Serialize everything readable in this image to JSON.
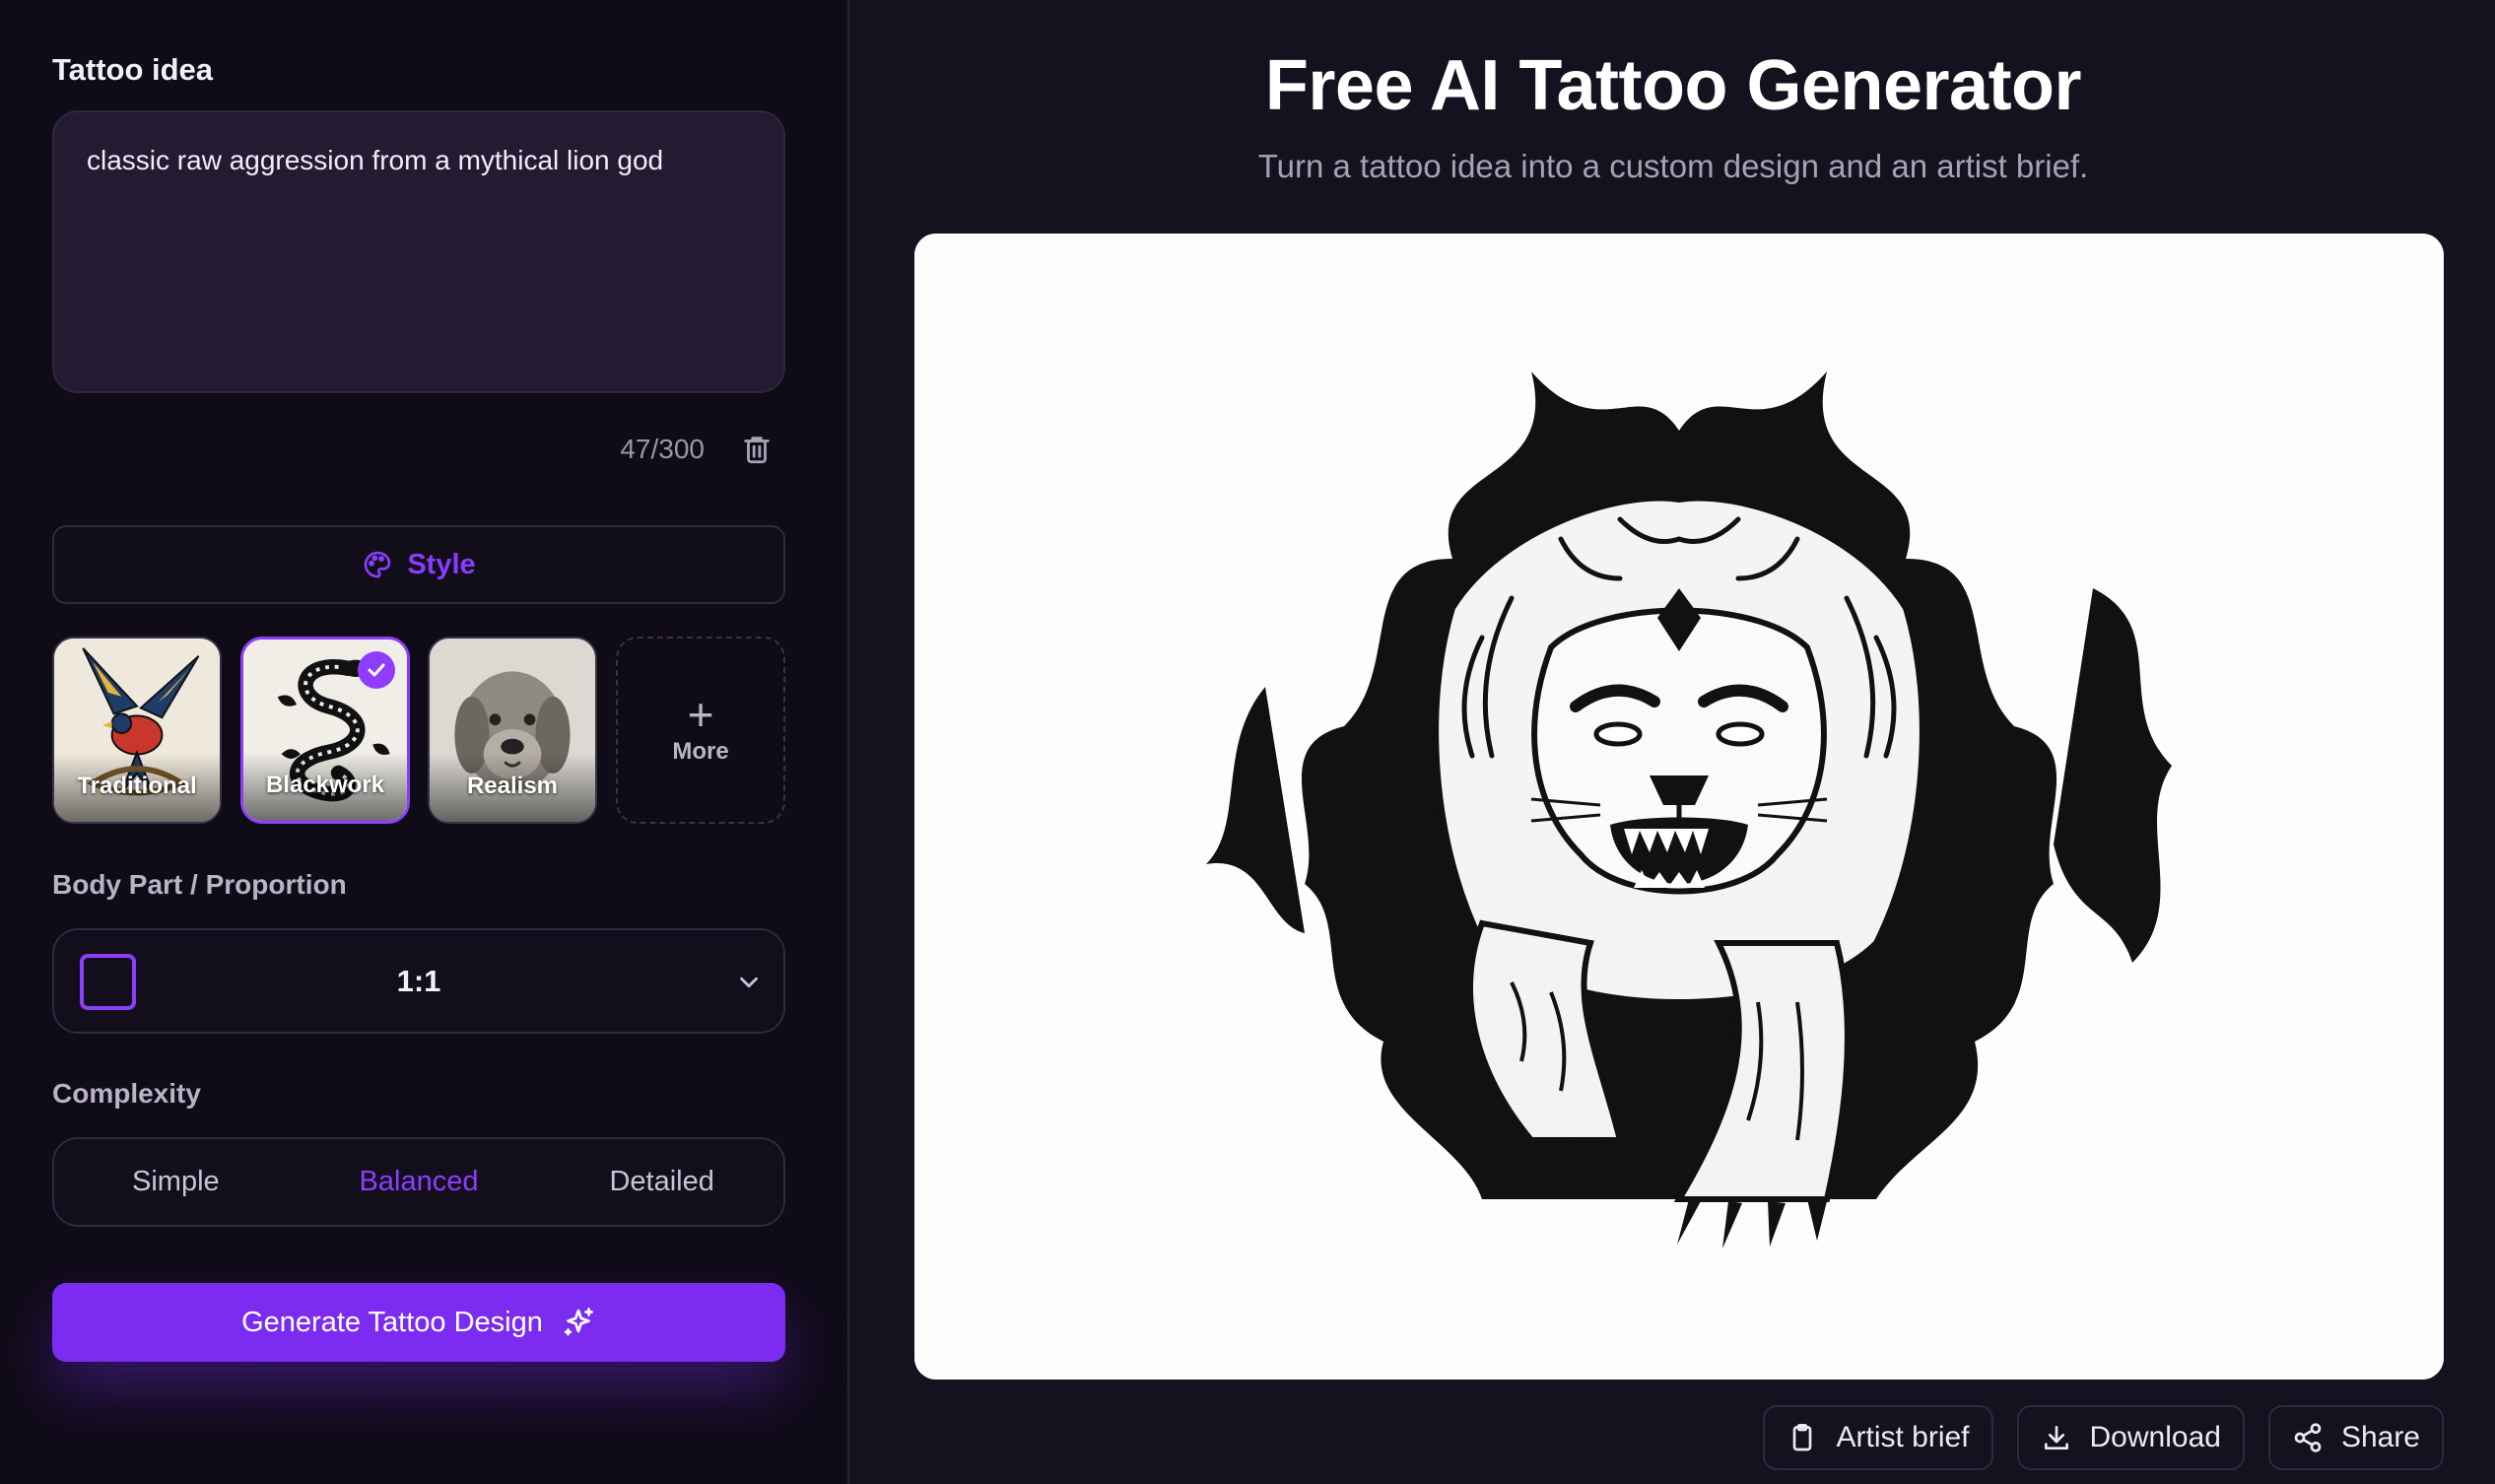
{
  "left": {
    "idea_label": "Tattoo idea",
    "idea_text": "classic raw aggression from a mythical lion god",
    "char_count": "47/300",
    "style_button": "Style",
    "styles": [
      {
        "label": "Traditional",
        "selected": false
      },
      {
        "label": "Blackwork",
        "selected": true
      },
      {
        "label": "Realism",
        "selected": false
      }
    ],
    "more_label": "More",
    "body_part_label": "Body Part / Proportion",
    "body_part_value": "1:1",
    "complexity_label": "Complexity",
    "complexity_options": [
      "Simple",
      "Balanced",
      "Detailed"
    ],
    "complexity_selected": "Balanced",
    "generate_label": "Generate Tattoo Design"
  },
  "right": {
    "title": "Free AI Tattoo Generator",
    "subtitle": "Turn a tattoo idea into a custom design and an artist brief.",
    "actions": [
      "Artist brief",
      "Download",
      "Share"
    ]
  },
  "colors": {
    "accent": "#8e3dff",
    "button": "#7b2cf0",
    "panel": "#0f0b17",
    "background": "#15111f"
  },
  "icons": [
    "trash-icon",
    "palette-icon",
    "check-icon",
    "plus-icon",
    "chevron-down-icon",
    "sparkle-icon",
    "clipboard-icon",
    "download-icon",
    "share-icon"
  ]
}
